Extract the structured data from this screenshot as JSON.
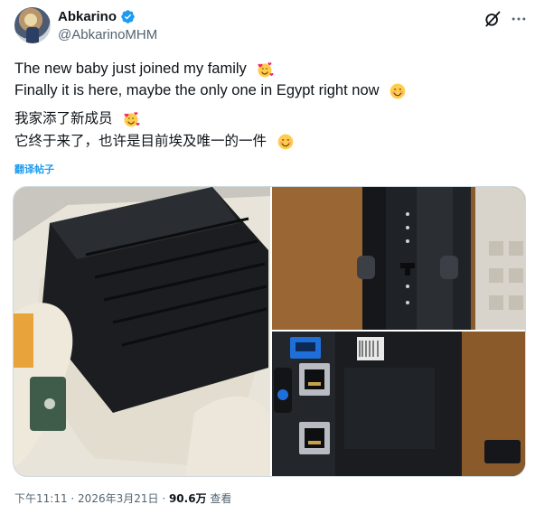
{
  "author": {
    "display_name": "Abkarino",
    "handle": "@AbkarinoMHM"
  },
  "tweet": {
    "line1": "The new baby just joined my family",
    "line2": "Finally it is here, maybe the only one in Egypt right now",
    "line3": "我家添了新成员",
    "line4": "它终于来了，也许是目前埃及唯一的一件",
    "translate_label": "翻译帖子"
  },
  "meta": {
    "time": "下午11:11",
    "separator": " · ",
    "date": "2026年3月21日",
    "views": "90.6万",
    "views_label": "查看"
  },
  "colors": {
    "accent": "#1d9bf0",
    "text": "#0f1419",
    "muted": "#536471",
    "border": "#cfd9de"
  },
  "icons": {
    "verified": "verified-badge-icon",
    "grok": "grok-icon",
    "more": "more-icon",
    "smile_hearts": "smiling-face-with-hearts-icon",
    "smile": "smiling-face-icon"
  }
}
